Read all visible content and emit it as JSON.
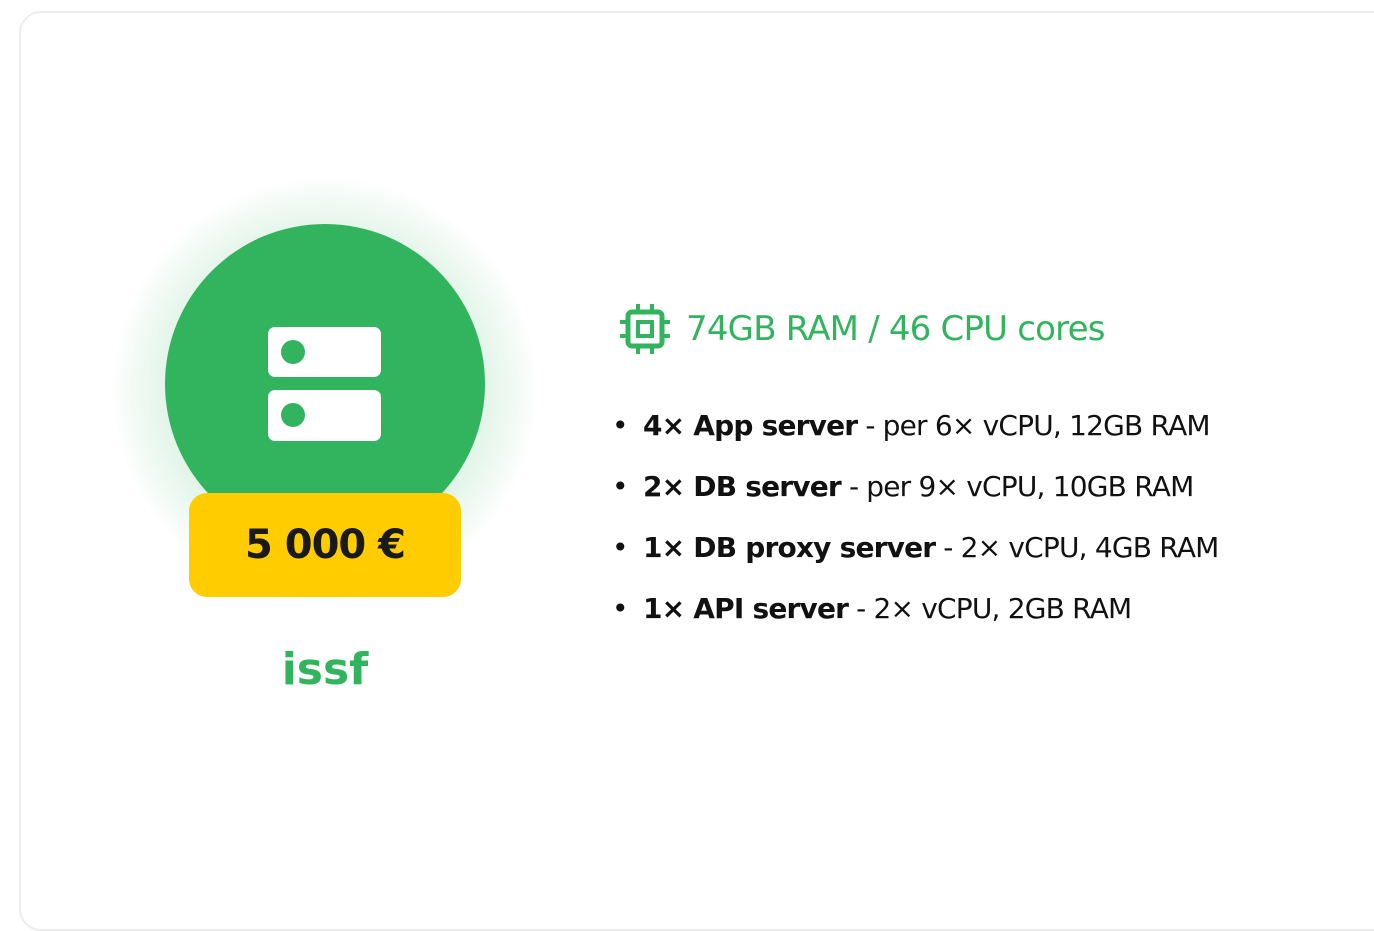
{
  "plan": {
    "price": "5 000 €",
    "name": "issf",
    "icon": "server-stack-icon"
  },
  "specs": {
    "icon": "cpu-chip-icon",
    "summary": "74GB RAM / 46 CPU cores",
    "items": [
      {
        "name": "4× App server",
        "separator": "-",
        "detail": "per 6× vCPU, 12GB RAM"
      },
      {
        "name": "2× DB server",
        "separator": "-",
        "detail": "per 9× vCPU, 10GB RAM"
      },
      {
        "name": "1× DB proxy server",
        "separator": "-",
        "detail": "2× vCPU, 4GB RAM"
      },
      {
        "name": "1× API server",
        "separator": "-",
        "detail": "2× vCPU, 2GB RAM"
      }
    ]
  },
  "colors": {
    "accent_green": "#32b35d",
    "price_badge": "#ffcc00",
    "text_dark": "#111111"
  }
}
